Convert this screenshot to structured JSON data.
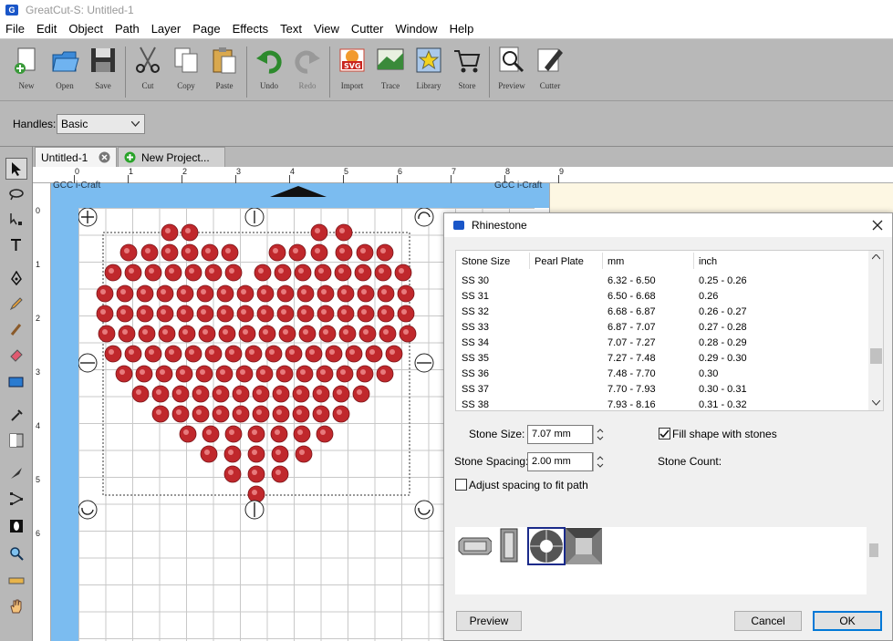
{
  "window": {
    "title": "GreatCut-S: Untitled-1"
  },
  "menu": [
    "File",
    "Edit",
    "Object",
    "Path",
    "Layer",
    "Page",
    "Effects",
    "Text",
    "View",
    "Cutter",
    "Window",
    "Help"
  ],
  "toolbar": {
    "items": [
      {
        "label": "New",
        "icon": "new-icon"
      },
      {
        "label": "Open",
        "icon": "open-folder-icon"
      },
      {
        "label": "Save",
        "icon": "save-disk-icon"
      },
      {
        "label": "Cut",
        "icon": "scissors-icon"
      },
      {
        "label": "Copy",
        "icon": "copy-icon"
      },
      {
        "label": "Paste",
        "icon": "paste-icon"
      },
      {
        "label": "Undo",
        "icon": "undo-icon"
      },
      {
        "label": "Redo",
        "icon": "redo-icon"
      },
      {
        "label": "Import",
        "icon": "import-svg-icon"
      },
      {
        "label": "Trace",
        "icon": "trace-icon"
      },
      {
        "label": "Library",
        "icon": "library-star-icon"
      },
      {
        "label": "Store",
        "icon": "store-cart-icon"
      },
      {
        "label": "Preview",
        "icon": "preview-magnifier-icon"
      },
      {
        "label": "Cutter",
        "icon": "cutter-pen-icon"
      }
    ]
  },
  "props": {
    "handles_label": "Handles:",
    "handles_value": "Basic"
  },
  "tabs": {
    "doc": "Untitled-1",
    "new_project": "New Project..."
  },
  "ruler": {
    "top": [
      "0",
      "1",
      "2",
      "3",
      "4",
      "5",
      "6",
      "7",
      "8",
      "9"
    ],
    "left": [
      "0",
      "1",
      "2",
      "3",
      "4",
      "5",
      "6"
    ]
  },
  "watermark": "GCC i-Craft",
  "dialog": {
    "title": "Rhinestone",
    "columns": [
      "Stone Size",
      "Pearl Plate",
      "mm",
      "inch"
    ],
    "rows": [
      {
        "size": "SS 30",
        "mm": "6.32 - 6.50",
        "inch": "0.25 - 0.26"
      },
      {
        "size": "SS 31",
        "mm": "6.50 - 6.68",
        "inch": "0.26"
      },
      {
        "size": "SS 32",
        "mm": "6.68 - 6.87",
        "inch": "0.26 - 0.27"
      },
      {
        "size": "SS 33",
        "mm": "6.87 - 7.07",
        "inch": "0.27 - 0.28"
      },
      {
        "size": "SS 34",
        "mm": "7.07 - 7.27",
        "inch": "0.28 - 0.29"
      },
      {
        "size": "SS 35",
        "mm": "7.27 - 7.48",
        "inch": "0.29 - 0.30"
      },
      {
        "size": "SS 36",
        "mm": "7.48 - 7.70",
        "inch": "0.30"
      },
      {
        "size": "SS 37",
        "mm": "7.70 - 7.93",
        "inch": "0.30 - 0.31"
      },
      {
        "size": "SS 38",
        "mm": "7.93 - 8.16",
        "inch": "0.31 - 0.32"
      }
    ],
    "stone_size_label": "Stone Size:",
    "stone_size_value": "7.07 mm",
    "stone_spacing_label": "Stone Spacing:",
    "stone_spacing_value": "2.00 mm",
    "fill_shape_label": "Fill shape with stones",
    "fill_shape_checked": true,
    "stone_count_label": "Stone Count:",
    "adjust_spacing_label": "Adjust spacing to fit path",
    "adjust_spacing_checked": false,
    "preview_label": "Preview",
    "cancel_label": "Cancel",
    "ok_label": "OK"
  },
  "colors": {
    "stone": "#c0282c",
    "ruler_blue": "#7bbcf0",
    "toolbar_bg": "#b8b8b8"
  }
}
